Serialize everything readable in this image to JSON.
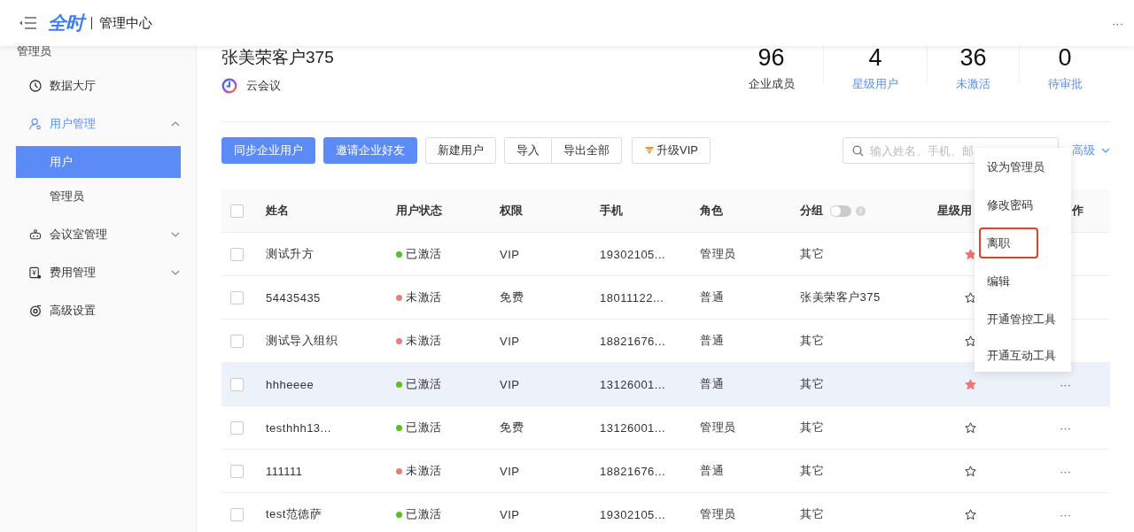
{
  "header": {
    "logo": "全时",
    "title": "管理中心",
    "more": "···"
  },
  "sidebar": {
    "section": "管理员",
    "items": [
      {
        "label": "数据大厅",
        "selected": false
      },
      {
        "label": "用户管理",
        "selected": false,
        "expanded": true,
        "children": [
          {
            "label": "用户",
            "selected": true
          },
          {
            "label": "管理员",
            "selected": false
          }
        ]
      },
      {
        "label": "会议室管理",
        "selected": false,
        "expanded": false
      },
      {
        "label": "费用管理",
        "selected": false,
        "expanded": false
      },
      {
        "label": "高级设置",
        "selected": false
      }
    ]
  },
  "company": {
    "name": "张美荣客户375",
    "product": "云会议"
  },
  "stats": [
    {
      "value": "96",
      "label": "企业成员",
      "link": false
    },
    {
      "value": "4",
      "label": "星级用户",
      "link": true
    },
    {
      "value": "36",
      "label": "未激活",
      "link": true
    },
    {
      "value": "0",
      "label": "待审批",
      "link": true
    }
  ],
  "toolbar": {
    "buttons": [
      {
        "label": "同步企业用户",
        "kind": "primary"
      },
      {
        "label": "邀请企业好友",
        "kind": "primary"
      },
      {
        "label": "新建用户",
        "kind": "default"
      },
      {
        "label": "导入",
        "kind": "segment-start"
      },
      {
        "label": "导出全部",
        "kind": "segment-end"
      },
      {
        "label": "升级VIP",
        "kind": "vip"
      }
    ],
    "search": {
      "placeholder": "输入姓名、手机、邮"
    },
    "advanced": "高级"
  },
  "table": {
    "header_checked": false,
    "columns": [
      "姓名",
      "用户状态",
      "权限",
      "手机",
      "角色",
      "分组",
      "星级用",
      "作"
    ],
    "group_toggle_on": false,
    "rows": [
      {
        "checked": false,
        "name": "测试升方",
        "status": "已激活",
        "active": true,
        "permission": "VIP",
        "phone": "19302105...",
        "role": "管理员",
        "group": "其它",
        "starred": true,
        "highlighted": false
      },
      {
        "checked": false,
        "name": "54435435",
        "status": "未激活",
        "active": false,
        "permission": "免费",
        "phone": "18011122...",
        "role": "普通",
        "group": "张美荣客户375",
        "starred": false,
        "highlighted": false
      },
      {
        "checked": false,
        "name": "测试导入组织",
        "status": "未激活",
        "active": false,
        "permission": "VIP",
        "phone": "18821676...",
        "role": "普通",
        "group": "其它",
        "starred": false,
        "highlighted": false
      },
      {
        "checked": false,
        "name": "hhheeee",
        "status": "已激活",
        "active": true,
        "permission": "VIP",
        "phone": "13126001...",
        "role": "普通",
        "group": "其它",
        "starred": true,
        "highlighted": true,
        "more": "···"
      },
      {
        "checked": false,
        "name": "testhhh13...",
        "status": "已激活",
        "active": true,
        "permission": "免费",
        "phone": "13126001...",
        "role": "管理员",
        "group": "其它",
        "starred": false,
        "highlighted": false,
        "more": "···"
      },
      {
        "checked": false,
        "name": "111111",
        "status": "未激活",
        "active": false,
        "permission": "VIP",
        "phone": "18821676...",
        "role": "普通",
        "group": "其它",
        "starred": false,
        "highlighted": false,
        "more": "···"
      },
      {
        "checked": false,
        "name": "test范德萨",
        "status": "已激活",
        "active": true,
        "permission": "VIP",
        "phone": "19302105...",
        "role": "管理员",
        "group": "其它",
        "starred": false,
        "highlighted": false,
        "more": "···"
      }
    ]
  },
  "dropdown": {
    "items": [
      {
        "label": "设为管理员",
        "outlined": false
      },
      {
        "label": "修改密码",
        "outlined": false
      },
      {
        "label": "离职",
        "outlined": true
      },
      {
        "label": "编辑",
        "outlined": false
      },
      {
        "label": "开通管控工具",
        "outlined": false
      },
      {
        "label": "开通互动工具",
        "outlined": false
      }
    ]
  }
}
